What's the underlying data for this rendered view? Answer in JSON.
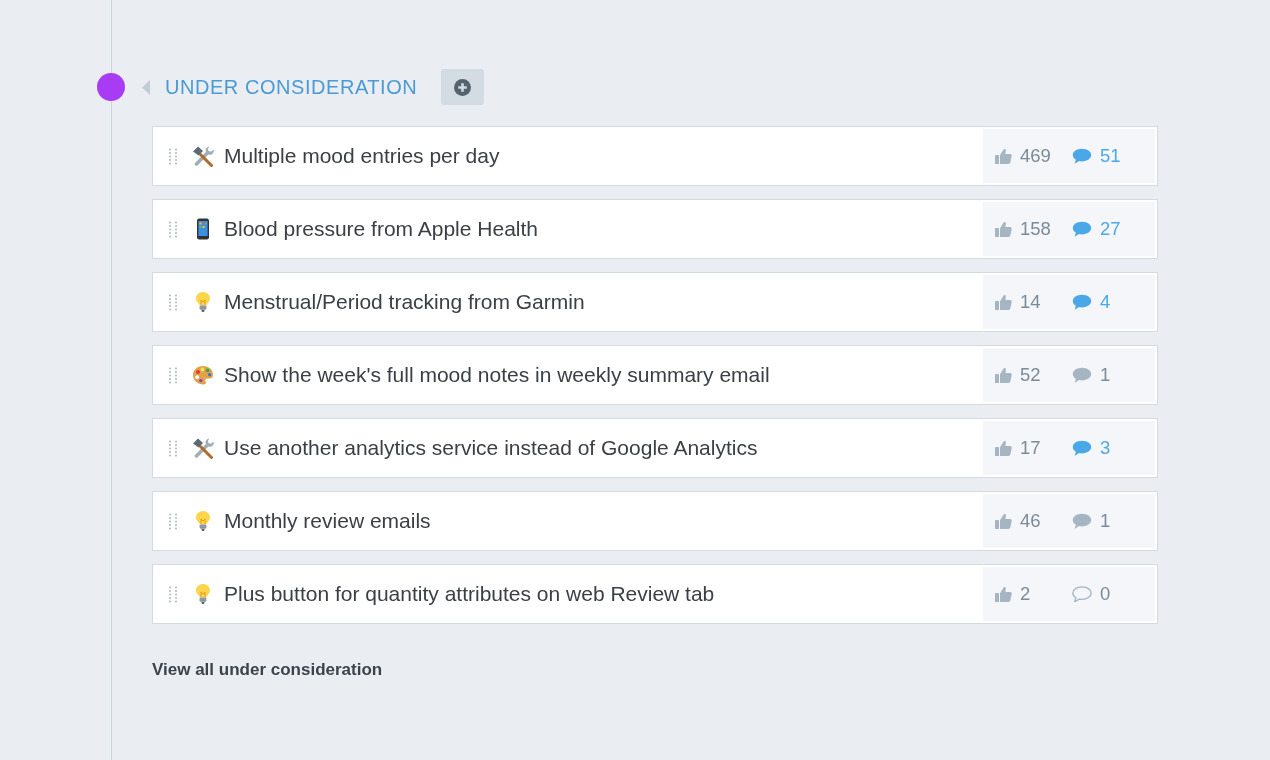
{
  "section": {
    "title": "UNDER CONSIDERATION"
  },
  "ideas": [
    {
      "kind": "tools",
      "title": "Multiple mood entries per day",
      "votes": "469",
      "comments": "51",
      "comments_highlighted": true,
      "comments_outline": false
    },
    {
      "kind": "phone",
      "title": "Blood pressure from Apple Health",
      "votes": "158",
      "comments": "27",
      "comments_highlighted": true,
      "comments_outline": false
    },
    {
      "kind": "bulb",
      "title": "Menstrual/Period tracking from Garmin",
      "votes": "14",
      "comments": "4",
      "comments_highlighted": true,
      "comments_outline": false
    },
    {
      "kind": "palette",
      "title": "Show the week's full mood notes in weekly summary email",
      "votes": "52",
      "comments": "1",
      "comments_highlighted": false,
      "comments_outline": false
    },
    {
      "kind": "tools",
      "title": "Use another analytics service instead of Google Analytics",
      "votes": "17",
      "comments": "3",
      "comments_highlighted": true,
      "comments_outline": false
    },
    {
      "kind": "bulb",
      "title": "Monthly review emails",
      "votes": "46",
      "comments": "1",
      "comments_highlighted": false,
      "comments_outline": false
    },
    {
      "kind": "bulb",
      "title": "Plus button for quantity attributes on web Review tab",
      "votes": "2",
      "comments": "0",
      "comments_highlighted": false,
      "comments_outline": true
    }
  ],
  "view_all_link": "View all under consideration"
}
